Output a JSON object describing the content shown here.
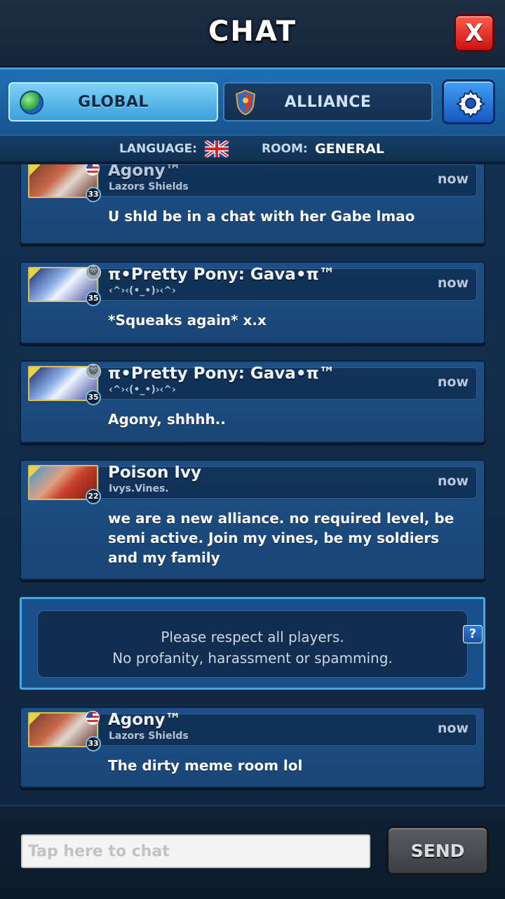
{
  "header": {
    "title": "CHAT",
    "close_label": "X"
  },
  "tabs": [
    {
      "label": "GLOBAL",
      "icon": "globe-icon",
      "active": true
    },
    {
      "label": "ALLIANCE",
      "icon": "shield-icon",
      "active": false
    }
  ],
  "settings": {
    "icon": "gear-icon"
  },
  "langbar": {
    "language_label": "LANGUAGE:",
    "language_flag": "uk-flag-icon",
    "room_label": "ROOM:",
    "room_value": "GENERAL"
  },
  "messages": [
    {
      "sender": "Agony™",
      "alliance": "Lazors Shields",
      "level": "33",
      "time": "now",
      "text": "U shld be in a chat with her Gabe lmao",
      "badge": "us-flag-icon"
    },
    {
      "sender": "π•Pretty Pony: Gava•π™",
      "alliance": "‹^›‹(•_•)›‹^›",
      "level": "35",
      "time": "now",
      "text": "*Squeaks again* x.x",
      "badge": "cat-icon"
    },
    {
      "sender": "π•Pretty Pony: Gava•π™",
      "alliance": "‹^›‹(•_•)›‹^›",
      "level": "35",
      "time": "now",
      "text": "Agony, shhhh..",
      "badge": "cat-icon"
    },
    {
      "sender": "Poison Ivy",
      "alliance": "Ivys.Vines.",
      "level": "22",
      "time": "now",
      "text": "we are a new alliance. no required level, be semi active. Join my vines, be my soldiers and my family",
      "badge": ""
    },
    {
      "sender": "Agony™",
      "alliance": "Lazors Shields",
      "level": "33",
      "time": "now",
      "text": "The dirty meme room lol",
      "badge": "us-flag-icon"
    }
  ],
  "notice": {
    "line1": "Please respect all players.",
    "line2": "No profanity, harassment or spamming.",
    "help": "?"
  },
  "footer": {
    "input_placeholder": "Tap here to chat",
    "input_value": "",
    "send_label": "SEND"
  },
  "colors": {
    "accent": "#3aa0dc",
    "close": "#d8241c",
    "panel": "#1d4f86"
  }
}
